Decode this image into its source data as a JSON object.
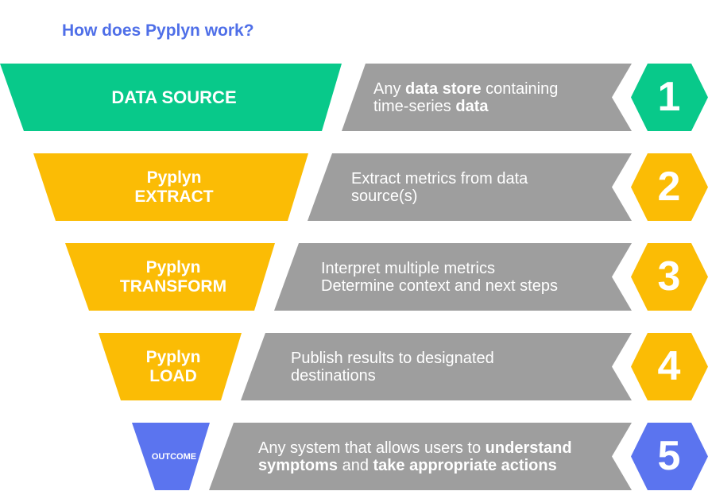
{
  "title": "How does Pyplyn work?",
  "colors": {
    "green": "#08c98a",
    "yellow": "#fbbc05",
    "blue": "#5b74ef",
    "gray": "#9e9e9e",
    "title": "#4f6fe8"
  },
  "stages": [
    {
      "label_lines": [
        "DATA SOURCE"
      ],
      "color": "green",
      "desc_segments": [
        {
          "text": "Any ",
          "bold": false
        },
        {
          "text": "data store",
          "bold": true
        },
        {
          "text": " containing",
          "bold": false
        },
        {
          "br": true
        },
        {
          "text": "time-series ",
          "bold": false
        },
        {
          "text": "data",
          "bold": true
        }
      ],
      "number": "1"
    },
    {
      "label_lines": [
        "Pyplyn",
        "EXTRACT"
      ],
      "color": "yellow",
      "desc_segments": [
        {
          "text": "Extract metrics from data",
          "bold": false
        },
        {
          "br": true
        },
        {
          "text": "source(s)",
          "bold": false
        }
      ],
      "number": "2"
    },
    {
      "label_lines": [
        "Pyplyn",
        "TRANSFORM"
      ],
      "color": "yellow",
      "desc_segments": [
        {
          "text": "Interpret multiple metrics",
          "bold": false
        },
        {
          "br": true
        },
        {
          "text": "Determine context and next steps",
          "bold": false
        }
      ],
      "number": "3"
    },
    {
      "label_lines": [
        "Pyplyn",
        "LOAD"
      ],
      "color": "yellow",
      "desc_segments": [
        {
          "text": "Publish results to designated",
          "bold": false
        },
        {
          "br": true
        },
        {
          "text": "destinations",
          "bold": false
        }
      ],
      "number": "4"
    },
    {
      "label_lines": [
        "OUTCOME"
      ],
      "color": "blue",
      "desc_segments": [
        {
          "text": "Any system that allows users to ",
          "bold": false
        },
        {
          "text": "understand",
          "bold": true
        },
        {
          "br": true
        },
        {
          "text": "symptoms",
          "bold": true
        },
        {
          "text": " and ",
          "bold": false
        },
        {
          "text": "take appropriate actions",
          "bold": true
        }
      ],
      "number": "5"
    }
  ]
}
